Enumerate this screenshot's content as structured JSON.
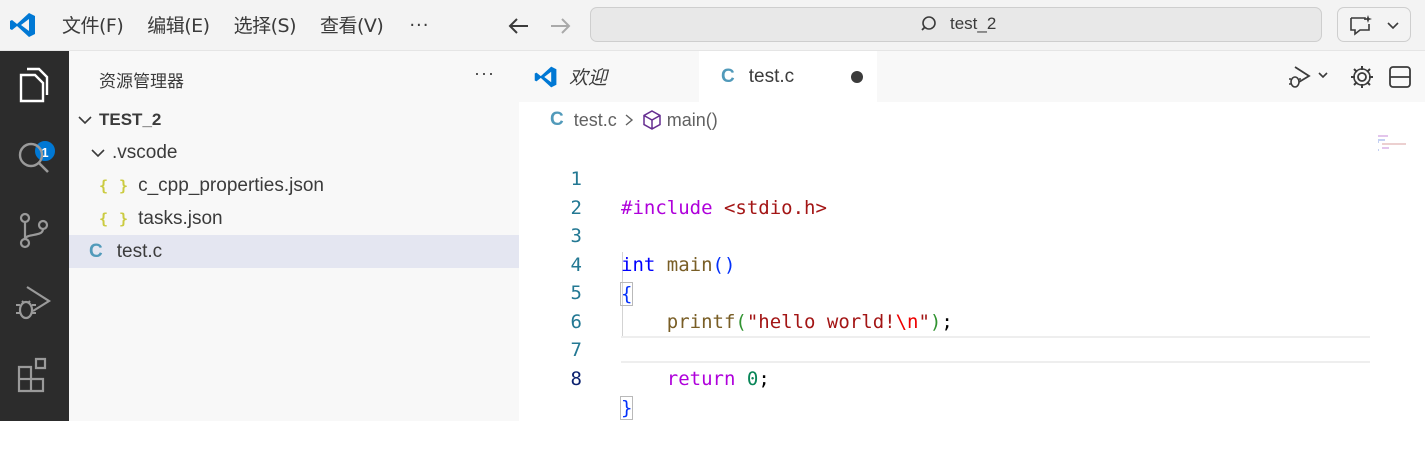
{
  "menu": {
    "items": [
      "文件(F)",
      "编辑(E)",
      "选择(S)",
      "查看(V)"
    ],
    "more": "···"
  },
  "command_center": {
    "text": "test_2"
  },
  "activity": {
    "explorer_badge": "1"
  },
  "sidebar": {
    "title": "资源管理器",
    "more": "···",
    "root": "TEST_2",
    "items": [
      {
        "label": ".vscode"
      },
      {
        "icon": "{ }",
        "label": "c_cpp_properties.json"
      },
      {
        "icon": "{ }",
        "label": "tasks.json"
      },
      {
        "icon": "C",
        "label": "test.c"
      }
    ]
  },
  "tabs": {
    "welcome": "欢迎",
    "active_icon": "C",
    "active": "test.c"
  },
  "breadcrumb": {
    "icon": "C",
    "file": "test.c",
    "symbol": "main()"
  },
  "editor": {
    "line_numbers": [
      "1",
      "2",
      "3",
      "4",
      "5",
      "6",
      "7",
      "8"
    ],
    "code": {
      "l1_pp": "#include",
      "l1_inc": "<stdio.h>",
      "l3_type": "int",
      "l3_fn": "main",
      "l3_par": "()",
      "l4_open": "{",
      "l5_fn": "printf",
      "l5_po": "(",
      "l5_str1": "\"hello world!",
      "l5_esc": "\\n",
      "l5_str2": "\"",
      "l5_pc": ")",
      "l5_semi": ";",
      "l7_kw": "return",
      "l7_num": "0",
      "l7_semi": ";",
      "l8_close": "}"
    }
  },
  "colors": {
    "activity_bg": "#2c2c2c",
    "accent": "#0078d4",
    "c_icon": "#519aba",
    "json_icon": "#cbcb41"
  }
}
